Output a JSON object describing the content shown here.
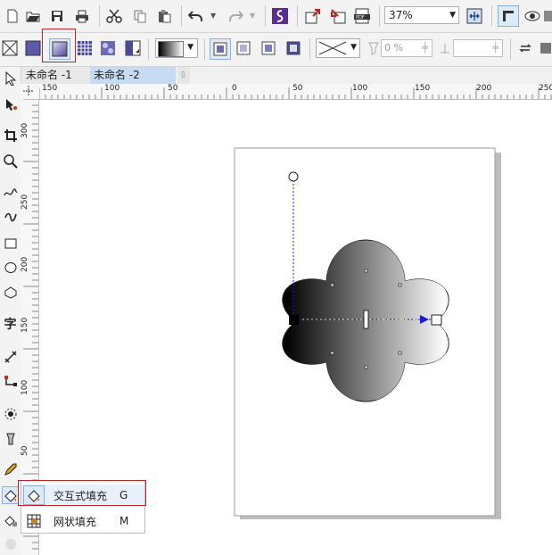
{
  "toolbar": {
    "zoom_value": "37%",
    "icons": [
      "new-icon",
      "open-icon",
      "save-icon",
      "print-icon",
      "cut-icon",
      "copy-icon",
      "paste-icon",
      "undo-icon",
      "redo-icon",
      "corel-launcher-icon",
      "import-icon",
      "export-icon",
      "publish-pdf-icon",
      "zoom-fit-icon",
      "options-icon",
      "view-icon",
      "snap-icon"
    ]
  },
  "property_bar": {
    "transparency_percent": "0 %"
  },
  "tabs": [
    {
      "label": "未命名 -1"
    },
    {
      "label": "未命名 -2"
    }
  ],
  "ruler": {
    "h_ticks": [
      "150",
      "100",
      "50",
      "0",
      "50",
      "100",
      "150",
      "200",
      "250"
    ],
    "v_ticks": [
      "300",
      "250",
      "200",
      "150",
      "100",
      "50"
    ]
  },
  "flyout": {
    "items": [
      {
        "label": "交互式填充",
        "shortcut": "G"
      },
      {
        "label": "网状填充",
        "shortcut": "M"
      }
    ]
  },
  "colors": {
    "highlight": "#c1232b",
    "tab_active": "#c7dcf2",
    "handle_blue": "#1c1cd8"
  }
}
